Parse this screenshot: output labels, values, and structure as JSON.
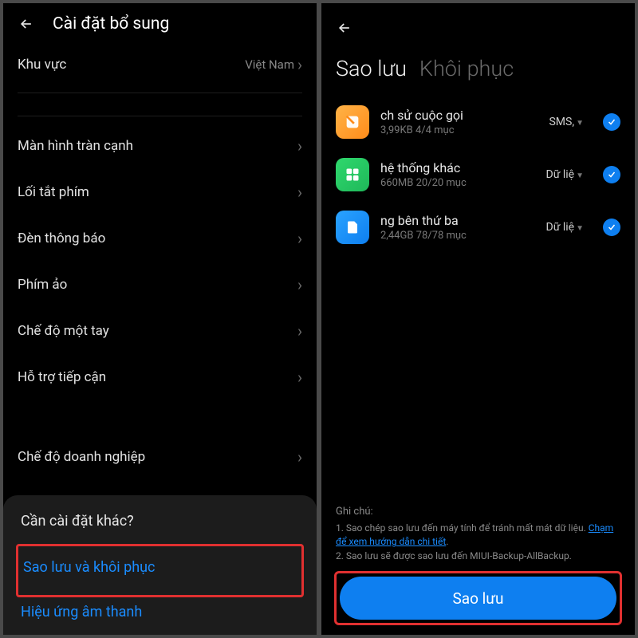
{
  "left": {
    "title": "Cài đặt bổ sung",
    "region": {
      "label": "Khu vực",
      "value": "Việt Nam"
    },
    "rows": [
      "Màn hình tràn cạnh",
      "Lối tắt phím",
      "Đèn thông báo",
      "Phím ảo",
      "Chế độ một tay",
      "Hỗ trợ tiếp cận"
    ],
    "enterprise": "Chế độ doanh nghiệp",
    "sheet": {
      "title": "Cần cài đặt khác?",
      "items": [
        "Sao lưu và khôi phục",
        "Hiệu ứng âm thanh"
      ]
    }
  },
  "right": {
    "tabs": {
      "active": "Sao lưu",
      "other": "Khôi phục"
    },
    "items": [
      {
        "title": "ch sử cuộc gọi",
        "sub": "3,99KB  4/4 mục",
        "type": "SMS,",
        "icon": "orange"
      },
      {
        "title": "hệ thống khác",
        "sub": "660MB  20/20 mục",
        "type": "Dữ liệ",
        "icon": "green"
      },
      {
        "title": "ng bên thứ ba",
        "sub": "2,44GB  78/78 mục",
        "type": "Dữ liệ",
        "icon": "blue"
      }
    ],
    "notes": {
      "title": "Ghi chú:",
      "line1a": "1. Sao chép sao lưu đến máy tính để tránh mất mát dữ liệu. ",
      "link": "Chạm để xem hướng dẫn chi tiết",
      "line2": "2. Sao lưu sẽ được sao lưu đến MIUI-Backup-AllBackup."
    },
    "button": "Sao lưu"
  }
}
